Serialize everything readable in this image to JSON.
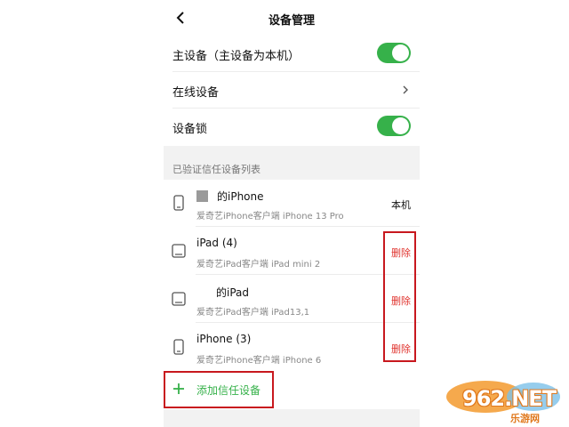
{
  "header": {
    "title": "设备管理",
    "back_icon": "chevron-left-icon"
  },
  "settings": {
    "main_device": {
      "label": "主设备（主设备为本机）",
      "enabled": true
    },
    "online_devices": {
      "label": "在线设备",
      "icon": "chevron-right-icon"
    },
    "device_lock": {
      "label": "设备锁",
      "enabled": true
    }
  },
  "trusted_section": {
    "title": "已验证信任设备列表"
  },
  "devices": [
    {
      "name": "的iPhone",
      "subtitle": "爱奇艺iPhone客户端 iPhone 13 Pro",
      "icon": "phone-icon",
      "action": "本机"
    },
    {
      "name": "iPad (4)",
      "subtitle": "爱奇艺iPad客户端 iPad mini 2",
      "icon": "tablet-icon",
      "action": "删除"
    },
    {
      "name": "的iPad",
      "subtitle": "爱奇艺iPad客户端 iPad13,1",
      "icon": "tablet-icon",
      "action": "删除"
    },
    {
      "name": "iPhone (3)",
      "subtitle": "爱奇艺iPhone客户端 iPhone 6",
      "icon": "phone-icon",
      "action": "删除"
    }
  ],
  "add_device": {
    "label": "添加信任设备",
    "icon": "plus-icon"
  },
  "watermark": {
    "logo": "962.NET",
    "sub": "乐游网"
  },
  "colors": {
    "accent": "#36b14a",
    "delete": "#e0342f",
    "highlight_box": "#c8181e",
    "background": "#f2f2f2"
  }
}
